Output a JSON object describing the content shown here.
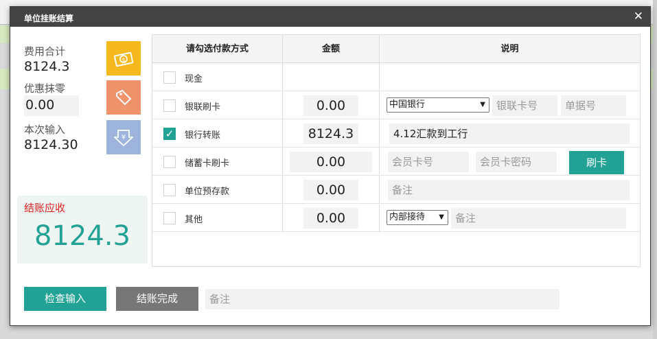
{
  "dialog": {
    "title": "单位挂账结算",
    "close": "✕"
  },
  "summary": {
    "total_label": "费用合计",
    "total_value": "8124.3",
    "discount_label": "优惠抹零",
    "discount_value": "0.00",
    "input_label": "本次输入",
    "input_value": "8124.30",
    "due_label": "结账应收",
    "due_value": "8124.3",
    "icons": [
      "money-icon",
      "tag-icon",
      "yuan-download-icon"
    ]
  },
  "table": {
    "headers": {
      "method": "请勾选付款方式",
      "amount": "金额",
      "desc": "说明"
    },
    "rows": [
      {
        "label": "现金",
        "checked": false
      },
      {
        "label": "银联刷卡",
        "checked": false,
        "amount": "0.00",
        "select": "中国银行",
        "card_no_placeholder": "银联卡号",
        "receipt_placeholder": "单据号"
      },
      {
        "label": "银行转账",
        "checked": true,
        "amount": "8124.3",
        "note": "4.12汇款到工行"
      },
      {
        "label": "储蓄卡刷卡",
        "checked": false,
        "amount": "0.00",
        "member_card_placeholder": "会员卡号",
        "member_pwd_placeholder": "会员卡密码",
        "swipe_button": "刷卡"
      },
      {
        "label": "单位预存款",
        "checked": false,
        "amount": "0.00",
        "note_placeholder": "备注"
      },
      {
        "label": "其他",
        "checked": false,
        "amount": "0.00",
        "select": "内部接待",
        "note_placeholder": "备注"
      }
    ]
  },
  "footer": {
    "check_button": "检查输入",
    "finish_button": "结账完成",
    "note_placeholder": "备注"
  },
  "colors": {
    "teal": "#22a295",
    "red": "#e01f1f",
    "title_bg": "#444444"
  }
}
